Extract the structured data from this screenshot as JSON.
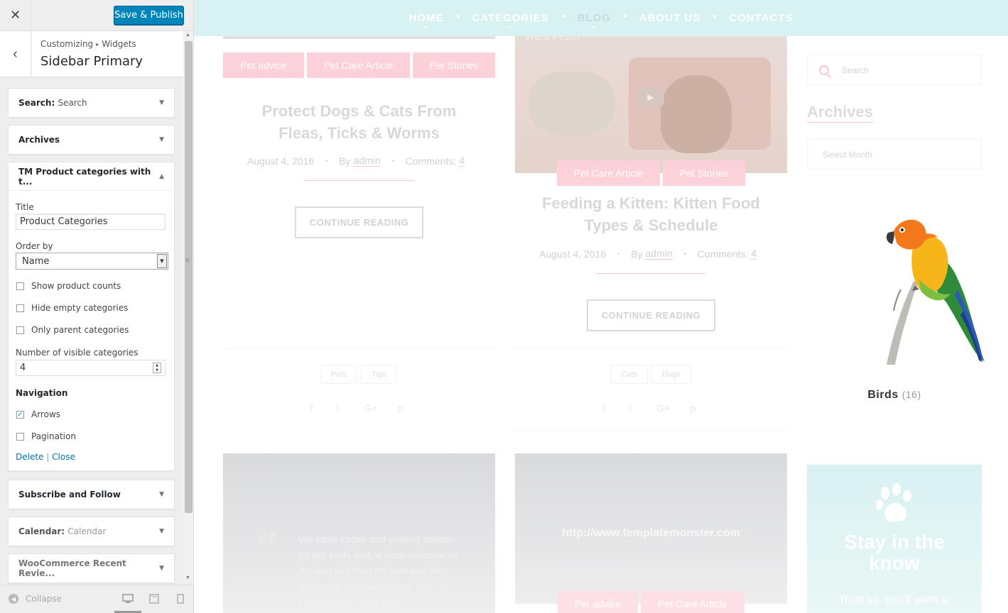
{
  "customizer": {
    "close_icon": "close-icon",
    "save_label": "Save & Publish",
    "breadcrumb": {
      "parent": "Customizing",
      "child": "Widgets"
    },
    "section_title": "Sidebar Primary",
    "widgets": [
      {
        "title": "Search",
        "subtitle": "Search"
      },
      {
        "title": "Archives",
        "subtitle": ""
      },
      {
        "title": "TM Product categories with t...",
        "subtitle": ""
      },
      {
        "title": "Subscribe and Follow",
        "subtitle": ""
      },
      {
        "title": "Calendar",
        "subtitle": "Calendar"
      },
      {
        "title": "WooCommerce Recent Revie...",
        "subtitle": ""
      }
    ],
    "form": {
      "title_label": "Title",
      "title_value": "Product Categories",
      "order_label": "Order by",
      "order_value": "Name",
      "checks": [
        {
          "label": "Show product counts",
          "checked": false
        },
        {
          "label": "Hide empty categories",
          "checked": false
        },
        {
          "label": "Only parent categories",
          "checked": false
        }
      ],
      "visible_label": "Number of visible categories",
      "visible_value": "4",
      "navigation_label": "Navigation",
      "nav_checks": [
        {
          "label": "Arrows",
          "checked": true
        },
        {
          "label": "Pagination",
          "checked": false
        }
      ],
      "delete_label": "Delete",
      "link_sep": "|",
      "close_label": "Close"
    },
    "footer": {
      "collapse_label": "Collapse"
    }
  },
  "preview": {
    "nav": [
      "HOME",
      "CATEGORIES",
      "BLOG",
      "ABOUT US",
      "CONTACTS"
    ],
    "active_nav": "BLOG",
    "post1": {
      "tags": [
        "Pet advice",
        "Pet Care Article",
        "Pet Stories"
      ],
      "title_line1": "Protect Dogs & Cats From",
      "title_line2": "Fleas, Ticks & Worms",
      "date": "August 4, 2016",
      "by": "By",
      "author": "admin",
      "comments_label": "Comments:",
      "comments_count": "4",
      "button": "CONTINUE READING",
      "post_tags": [
        "Pets",
        "Tips"
      ]
    },
    "post2": {
      "video_title": "Went Fetch",
      "tags": [
        "Pet Care Article",
        "Pet Stories"
      ],
      "title_line1": "Feeding a Kitten: Kitten Food",
      "title_line2": "Types & Schedule",
      "date": "August 4, 2016",
      "by": "By",
      "author": "admin",
      "comments_label": "Comments:",
      "comments_count": "4",
      "button": "CONTINUE READING",
      "post_tags": [
        "Cats",
        "Dogs"
      ]
    },
    "quote": {
      "mark": "“",
      "text": "We have cages and playing stands for pet birds and, a wide selection of dry and wet food for cats and dogs, grooming and playing sup-plies for both big and small pets."
    },
    "link_post": {
      "url": "http://www.templatemonster.com",
      "tags": [
        "Pet advice",
        "Pet Care Article"
      ]
    },
    "sidebar": {
      "search_placeholder": "Search",
      "archives_title": "Archives",
      "select_month": "Select Month",
      "category_name": "Birds",
      "category_count": "(16)",
      "newsletter_title_line1": "Stay in the",
      "newsletter_title_line2": "know",
      "newsletter_sub": "Trust us, you'll want to"
    }
  }
}
